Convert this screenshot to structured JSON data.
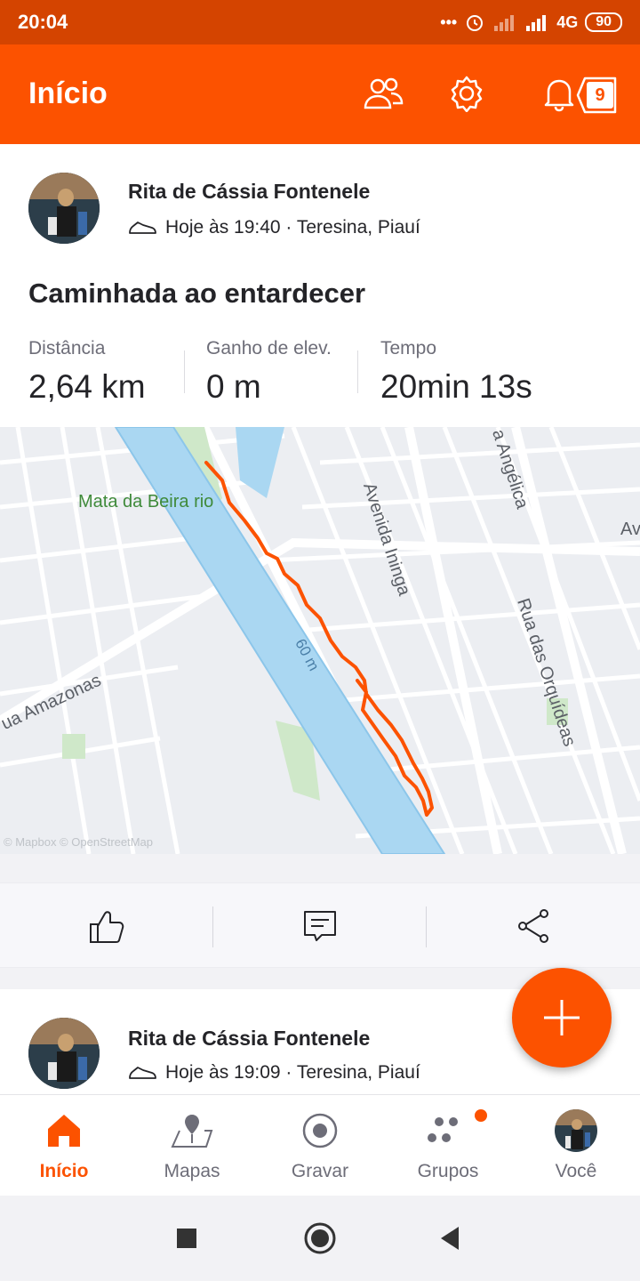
{
  "status_bar": {
    "time": "20:04",
    "network": "4G",
    "battery": "90"
  },
  "app_bar": {
    "title": "Início",
    "notifications_count": "9"
  },
  "activity": {
    "author": "Rita de Cássia Fontenele",
    "meta": "Hoje às 19:40 · Teresina, Piauí",
    "title": "Caminhada ao entardecer",
    "stats": [
      {
        "label": "Distância",
        "value": "2,64 km"
      },
      {
        "label": "Ganho de elev.",
        "value": "0 m"
      },
      {
        "label": "Tempo",
        "value": "20min 13s"
      }
    ],
    "map": {
      "labels": {
        "park": "Mata da Beira rio",
        "avenida_ininga": "Avenida Ininga",
        "angelica": "a Angélica",
        "orquideas": "Rua das Orquídeas",
        "amazonas": "ua Amazonas",
        "river": "60 m",
        "edge": "Av"
      },
      "attribution": "© Mapbox © OpenStreetMap"
    }
  },
  "activity2": {
    "author": "Rita de Cássia Fontenele",
    "meta": "Hoje às 19:09 · Teresina, Piauí"
  },
  "tabs": [
    {
      "label": "Início",
      "icon": "home-icon",
      "active": true
    },
    {
      "label": "Mapas",
      "icon": "map-pin-icon"
    },
    {
      "label": "Gravar",
      "icon": "record-icon"
    },
    {
      "label": "Grupos",
      "icon": "groups-icon"
    },
    {
      "label": "Você",
      "icon": "profile-avatar"
    }
  ],
  "colors": {
    "brand": "#fc5200",
    "status_bar": "#d44400",
    "text": "#242428",
    "muted": "#6d6d78",
    "river": "#aad7f2",
    "park": "#cfe8c9"
  }
}
